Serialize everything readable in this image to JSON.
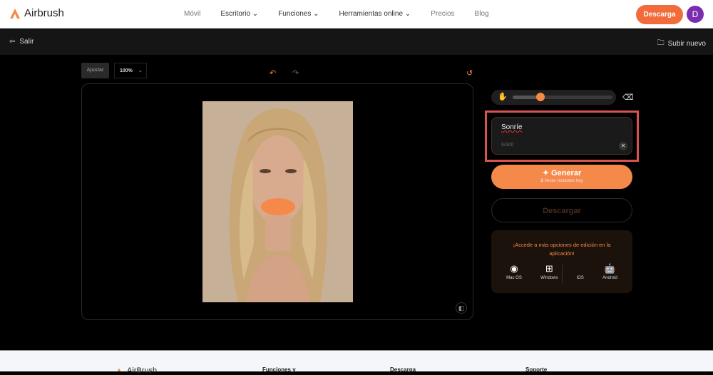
{
  "header": {
    "brand": "Airbrush",
    "nav": [
      "Móvil",
      "Escritorio",
      "Funciones",
      "Herramientas online",
      "Precios",
      "Blog"
    ],
    "download": "Descarga",
    "avatar": "D"
  },
  "toolbar": {
    "exit": "Salir",
    "upload_new": "Subir nuevo"
  },
  "editor": {
    "fit": "Ajustar",
    "zoom": "100%"
  },
  "brush": {
    "size_fraction": 0.28
  },
  "prompt": {
    "value": "Sonríe",
    "counter": "6/300"
  },
  "generate": {
    "label": "Generar",
    "remaining_count": "2",
    "remaining_text": "Veces restantes hoy"
  },
  "download_button": "Descargar",
  "promo": {
    "text": "¡Accede a más opciones de edición en la aplicación!",
    "apps": [
      "Mac OS",
      "Windows",
      "iOS",
      "Android"
    ]
  },
  "footer": {
    "columns": [
      "AirBrush",
      "Funciones y",
      "Descarga",
      "Soporte"
    ]
  },
  "colors": {
    "accent": "#f5894a",
    "brand": "#f26b3a",
    "highlight": "#d9534f"
  }
}
